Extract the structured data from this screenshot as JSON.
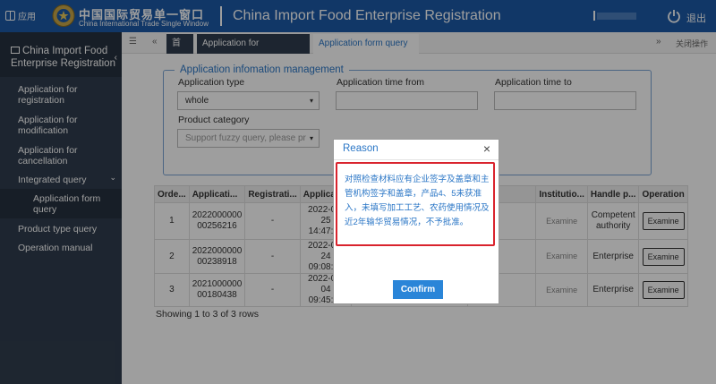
{
  "header": {
    "apps_label": "应用",
    "brand_cn": "中国国际贸易单一窗口",
    "brand_en": "China International Trade Single Window",
    "system_title": "China Import Food Enterprise Registration",
    "logout_label": "退出"
  },
  "sidebar": {
    "title": "China Import Food Enterprise Registration",
    "items": [
      {
        "label": "Application for registration"
      },
      {
        "label": "Application for modification"
      },
      {
        "label": "Application for cancellation"
      },
      {
        "label": "Integrated query"
      },
      {
        "label": "Application form query"
      },
      {
        "label": "Product type query"
      },
      {
        "label": "Operation manual"
      }
    ]
  },
  "tabs": {
    "home": "首页",
    "registration": "Application for registration",
    "form_query": "Application form query",
    "close_ops": "关闭操作"
  },
  "filter": {
    "legend": "Application infomation management",
    "type_label": "Application type",
    "type_value": "whole",
    "time_from_label": "Application time from",
    "time_to_label": "Application time to",
    "category_label": "Product category",
    "category_placeholder": "Support fuzzy query, please pr"
  },
  "table": {
    "headers": [
      "Orde...",
      "Applicati...",
      "Registrati...",
      "Applicati...",
      "",
      "",
      "Institutio...",
      "Handle p...",
      "Operation"
    ],
    "rows": [
      {
        "order": "1",
        "app_no": "2022000000 00256216",
        "reg": "-",
        "date": "2022-01-25 14:47:52",
        "institution_action": "Examine",
        "handler": "Competent authority",
        "op": "Examine"
      },
      {
        "order": "2",
        "app_no": "2022000000 00238918",
        "reg": "-",
        "date": "2022-01-24 09:08:36",
        "institution_action": "Examine",
        "handler": "Enterprise",
        "op": "Examine"
      },
      {
        "order": "3",
        "app_no": "2021000000 00180438",
        "reg": "-",
        "date": "2022-01-04 09:45:18",
        "institution_action": "Examine",
        "handler": "Enterprise",
        "op": "Examine"
      }
    ],
    "summary": "Showing 1 to 3 of 3 rows"
  },
  "modal": {
    "title": "Reason",
    "body": "对照检查材料应有企业签字及盖章和主管机构签字和盖章，产品4、5未获准入，未填写加工工艺、农药使用情况及近2年输华贸易情况，不予批准。",
    "confirm_label": "Confirm"
  },
  "colors": {
    "header_bg": "#1c5aa7",
    "sidebar_bg": "#303d4e",
    "accent": "#2a76c6",
    "highlight_border": "#d9232d"
  }
}
